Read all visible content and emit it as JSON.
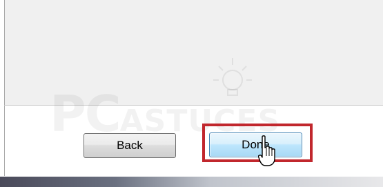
{
  "dialog": {
    "buttons": {
      "back_label": "Back",
      "done_label": "Done"
    }
  },
  "watermark": {
    "pc": "PC",
    "rest": "ASTUCES"
  },
  "colors": {
    "highlight": "#c1272d",
    "done_button_border": "#3c7fb1"
  }
}
